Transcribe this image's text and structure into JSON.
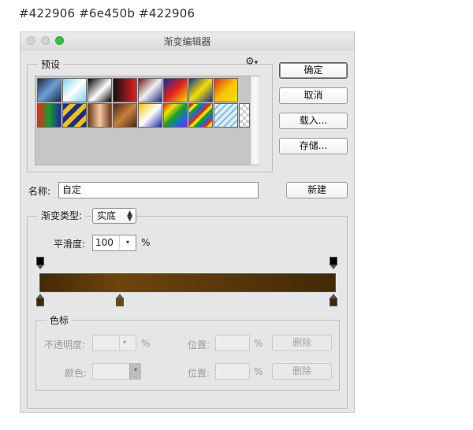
{
  "caption": "#422906  #6e450b  #422906",
  "window": {
    "title": "渐变编辑器"
  },
  "presets": {
    "label": "预设",
    "menu_icon": "gear-icon",
    "swatches": [
      [
        "linear-gradient(135deg,#1a2a44,#6f9fd6,#1a2a44)",
        "linear-gradient(135deg,#7fd0f4,#ffffff 50%,#7fd0f4)",
        "linear-gradient(135deg,#000000,#ffffff 55%,#000000)",
        "linear-gradient(90deg,#111111,#e02020)",
        "linear-gradient(135deg,#6b1b1b,#f0f0f0 50%,#1e2a8a)",
        "linear-gradient(135deg,#1a2a9c,#e02020 50%,#f4e200)",
        "linear-gradient(135deg,#1a2a9c,#f4e200 50%,#1a2a9c)",
        "linear-gradient(135deg,#e22a1a,#f8c200 50%,#f4e600)"
      ],
      [
        "linear-gradient(90deg,#e22a1a,#1a9c2a,#1a2a9c)",
        "repeating-linear-gradient(135deg,#1a2a9c 0 6px,#f4c200 6px 12px)",
        "linear-gradient(90deg,#6b3b1b,#f6c8a0,#6b3b1b)",
        "linear-gradient(135deg,#4a2a1a,#c8803a,#4a2a1a)",
        "linear-gradient(135deg,#f4c200,#ffffff 50%,#1a2a9c)",
        "linear-gradient(135deg,#e22a1a,#f4e200,#1a9c2a,#1a6ae0,#9a1ae0)",
        "repeating-linear-gradient(135deg,#e22a1a 0 4px,#f4e200 4px 8px,#1a9c2a 8px 12px,#1a6ae0 12px 16px)",
        "repeating-linear-gradient(135deg,#d8eef8 0 4px,#7ab8dc 4px 6px)"
      ]
    ],
    "last_swatch": "transparent-checker"
  },
  "buttons": {
    "ok": "确定",
    "cancel": "取消",
    "load": "载入...",
    "save": "存储...",
    "new": "新建"
  },
  "name": {
    "label": "名称:",
    "value": "自定"
  },
  "gradient_type": {
    "label": "渐变类型:",
    "value": "实底"
  },
  "smoothness": {
    "label": "平滑度:",
    "value": "100",
    "unit": "%"
  },
  "gradient": {
    "colors": [
      "#422906",
      "#6e450b",
      "#422906"
    ],
    "opacity_stops": [
      0,
      1
    ],
    "color_stops": [
      0,
      0.27,
      1
    ]
  },
  "stops_group": {
    "label": "色标",
    "opacity_label": "不透明度:",
    "opacity_unit": "%",
    "position_label": "位置:",
    "position_unit": "%",
    "delete_label": "删除",
    "color_label": "颜色:",
    "position2_label": "位置:",
    "position2_unit": "%",
    "delete2_label": "删除"
  }
}
